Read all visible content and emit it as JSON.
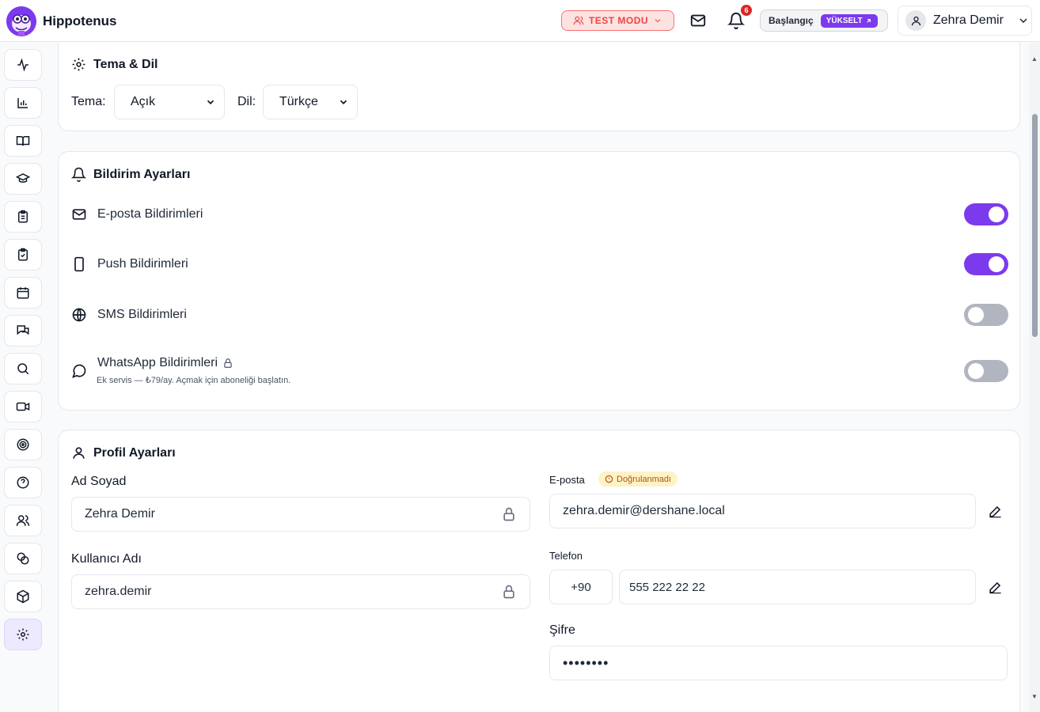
{
  "header": {
    "brand": "Hippotenus",
    "test_mode_label": "TEST MODU",
    "notification_count": "6",
    "plan_name": "Başlangıç",
    "upgrade_label": "YÜKSELT",
    "user_name": "Zehra Demir"
  },
  "sidebar": {
    "items": [
      {
        "icon": "activity-icon"
      },
      {
        "icon": "bar-chart-icon"
      },
      {
        "icon": "book-open-icon"
      },
      {
        "icon": "graduation-cap-icon"
      },
      {
        "icon": "clipboard-list-icon"
      },
      {
        "icon": "clipboard-check-icon"
      },
      {
        "icon": "calendar-icon"
      },
      {
        "icon": "messages-icon"
      },
      {
        "icon": "search-icon"
      },
      {
        "icon": "video-icon"
      },
      {
        "icon": "target-icon"
      },
      {
        "icon": "help-circle-icon"
      },
      {
        "icon": "users-icon"
      },
      {
        "icon": "coins-icon"
      },
      {
        "icon": "package-icon"
      },
      {
        "icon": "settings-icon"
      }
    ],
    "active_index": 15
  },
  "theme": {
    "title": "Tema & Dil",
    "theme_label": "Tema:",
    "theme_value": "Açık",
    "lang_label": "Dil:",
    "lang_value": "Türkçe"
  },
  "notifications": {
    "title": "Bildirim Ayarları",
    "items": [
      {
        "label": "E-posta Bildirimleri",
        "enabled": true
      },
      {
        "label": "Push Bildirimleri",
        "enabled": true
      },
      {
        "label": "SMS Bildirimleri",
        "enabled": false
      },
      {
        "label": "WhatsApp Bildirimleri",
        "enabled": false,
        "note": "Ek servis — ₺79/ay. Açmak için aboneliği başlatın."
      }
    ]
  },
  "profile": {
    "title": "Profil Ayarları",
    "fullname_label": "Ad Soyad",
    "fullname_value": "Zehra Demir",
    "username_label": "Kullanıcı Adı",
    "username_value": "zehra.demir",
    "email_label": "E-posta",
    "email_status": "Doğrulanmadı",
    "email_value": "zehra.demir@dershane.local",
    "phone_label": "Telefon",
    "phone_code": "+90",
    "phone_value": "555 222 22 22",
    "password_label": "Şifre",
    "password_value": "••••••••"
  },
  "colors": {
    "accent": "#7c3aed",
    "danger": "#ef4444",
    "warning": "#b45309"
  }
}
